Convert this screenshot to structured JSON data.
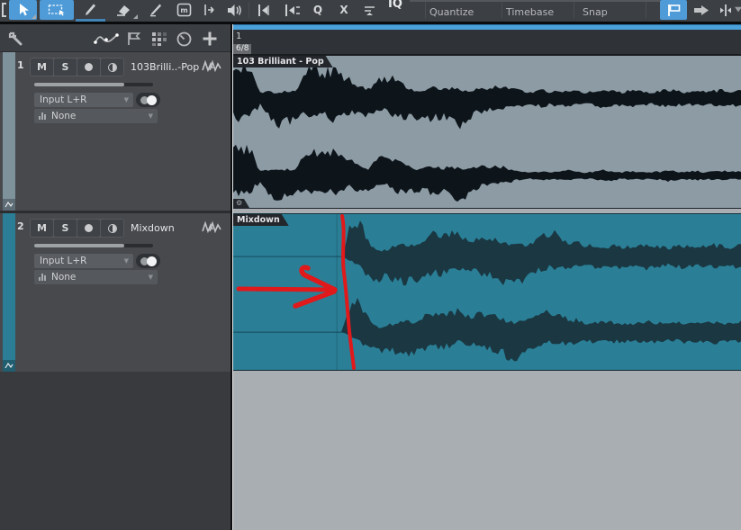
{
  "toolbar": {
    "tools": {
      "mute_glyph": "m",
      "q_glyph": "Q",
      "x_glyph": "X"
    },
    "iq_label": "IQ",
    "dropdown_labels": [
      "Quantize",
      "Timebase",
      "Snap"
    ],
    "accent_color": "#4E9BD8",
    "scrollbar_color": "#4AA0D8"
  },
  "track_panel": {
    "tracks": [
      {
        "number": "1",
        "mute": "M",
        "solo": "S",
        "name": "103Brilli..-Pop",
        "input": "Input L+R",
        "insert": "None",
        "color": "#7E929C"
      },
      {
        "number": "2",
        "mute": "M",
        "solo": "S",
        "name": "Mixdown",
        "input": "Input L+R",
        "insert": "None",
        "color": "#2B7E96"
      }
    ]
  },
  "arrange": {
    "ruler": {
      "bar_number": "1",
      "time_signature": "6/8"
    },
    "clips": [
      {
        "label": "103 Brilliant - Pop",
        "bg": "#8C9BA4",
        "wave": "#0D141A"
      },
      {
        "label": "Mixdown",
        "bg": "#2A7F96",
        "wave": "#1A3742"
      }
    ],
    "gear_glyph": "⚙",
    "annotation_color": "#E0191B"
  },
  "waveforms": {
    "t1l1u": [
      0.85,
      0.9,
      0.8,
      0.15,
      0.2,
      0.15,
      0.2,
      0.25,
      0.75,
      0.85,
      0.7,
      0.8,
      0.65,
      0.5,
      0.3,
      0.25,
      0.55,
      0.6,
      0.5,
      0.35,
      0.2,
      0.25,
      0.3,
      0.25,
      0.3,
      0.25,
      0.2,
      0.3,
      0.3,
      0.35,
      0.3,
      0.25,
      0.2,
      0.18,
      0.22,
      0.17,
      0.2,
      0.24,
      0.18,
      0.16,
      0.2,
      0.26,
      0.2,
      0.17,
      0.22,
      0.18,
      0.16,
      0.2,
      0.24,
      0.19,
      0.17,
      0.21,
      0.18,
      0.2,
      0.23,
      0.19,
      0.2
    ],
    "t1l1d": [
      0.55,
      0.6,
      0.5,
      0.2,
      0.6,
      0.75,
      0.7,
      0.55,
      0.45,
      0.55,
      0.5,
      0.6,
      0.45,
      0.4,
      0.5,
      0.45,
      0.3,
      0.35,
      0.55,
      0.6,
      0.55,
      0.5,
      0.6,
      0.55,
      0.65,
      0.75,
      0.6,
      0.4,
      0.35,
      0.3,
      0.28,
      0.28,
      0.22,
      0.2,
      0.24,
      0.19,
      0.22,
      0.26,
      0.2,
      0.18,
      0.22,
      0.28,
      0.22,
      0.19,
      0.24,
      0.2,
      0.18,
      0.22,
      0.26,
      0.21,
      0.19,
      0.23,
      0.2,
      0.22,
      0.25,
      0.21,
      0.22
    ],
    "t1l2u": [
      0.8,
      0.85,
      0.7,
      0.12,
      0.18,
      0.14,
      0.18,
      0.22,
      0.65,
      0.75,
      0.6,
      0.7,
      0.55,
      0.45,
      0.25,
      0.2,
      0.5,
      0.55,
      0.45,
      0.3,
      0.18,
      0.22,
      0.26,
      0.22,
      0.26,
      0.22,
      0.18,
      0.26,
      0.26,
      0.3,
      0.24,
      0.14,
      0.11,
      0.1,
      0.13,
      0.1,
      0.12,
      0.15,
      0.1,
      0.09,
      0.12,
      0.16,
      0.12,
      0.1,
      0.13,
      0.1,
      0.09,
      0.12,
      0.15,
      0.11,
      0.1,
      0.13,
      0.1,
      0.12,
      0.14,
      0.11,
      0.12
    ],
    "t1l2d": [
      0.5,
      0.55,
      0.45,
      0.18,
      0.55,
      0.7,
      0.65,
      0.5,
      0.4,
      0.5,
      0.45,
      0.55,
      0.4,
      0.35,
      0.45,
      0.4,
      0.28,
      0.3,
      0.5,
      0.55,
      0.5,
      0.45,
      0.55,
      0.5,
      0.6,
      0.7,
      0.55,
      0.35,
      0.3,
      0.26,
      0.24,
      0.16,
      0.12,
      0.11,
      0.14,
      0.11,
      0.13,
      0.16,
      0.11,
      0.1,
      0.13,
      0.17,
      0.13,
      0.11,
      0.14,
      0.11,
      0.1,
      0.13,
      0.16,
      0.12,
      0.11,
      0.14,
      0.11,
      0.13,
      0.15,
      0.12,
      0.13
    ],
    "t2l1u": [
      0,
      0,
      0,
      0,
      0,
      0,
      0,
      0,
      0,
      0,
      0,
      0,
      0,
      0.92,
      0.88,
      0.35,
      0.15,
      0.2,
      0.28,
      0.34,
      0.3,
      0.5,
      0.62,
      0.55,
      0.68,
      0.6,
      0.45,
      0.52,
      0.56,
      0.48,
      0.35,
      0.3,
      0.32,
      0.42,
      0.5,
      0.66,
      0.58,
      0.4,
      0.36,
      0.3,
      0.28,
      0.26,
      0.3,
      0.27,
      0.23,
      0.28,
      0.33,
      0.26,
      0.23,
      0.27,
      0.31,
      0.25,
      0.27,
      0.31,
      0.28,
      0.25,
      0.3
    ],
    "t2l1d": [
      0,
      0,
      0,
      0,
      0,
      0,
      0,
      0,
      0,
      0,
      0,
      0,
      0,
      0.12,
      0.3,
      0.55,
      0.6,
      0.5,
      0.68,
      0.76,
      0.64,
      0.5,
      0.44,
      0.5,
      0.4,
      0.32,
      0.36,
      0.44,
      0.5,
      0.54,
      0.72,
      0.8,
      0.66,
      0.45,
      0.36,
      0.3,
      0.32,
      0.36,
      0.3,
      0.29,
      0.31,
      0.27,
      0.31,
      0.29,
      0.25,
      0.3,
      0.35,
      0.28,
      0.25,
      0.29,
      0.32,
      0.27,
      0.29,
      0.32,
      0.29,
      0.27,
      0.31
    ],
    "t2l2u": [
      0,
      0,
      0,
      0,
      0,
      0,
      0,
      0,
      0,
      0,
      0,
      0,
      0,
      0.88,
      0.84,
      0.33,
      0.14,
      0.19,
      0.27,
      0.32,
      0.28,
      0.47,
      0.59,
      0.52,
      0.65,
      0.57,
      0.43,
      0.49,
      0.53,
      0.46,
      0.33,
      0.28,
      0.3,
      0.4,
      0.48,
      0.63,
      0.55,
      0.38,
      0.34,
      0.28,
      0.27,
      0.25,
      0.28,
      0.26,
      0.22,
      0.27,
      0.31,
      0.25,
      0.22,
      0.26,
      0.29,
      0.24,
      0.26,
      0.29,
      0.27,
      0.24,
      0.28
    ],
    "t2l2d": [
      0,
      0,
      0,
      0,
      0,
      0,
      0,
      0,
      0,
      0,
      0,
      0,
      0,
      0.11,
      0.28,
      0.52,
      0.57,
      0.48,
      0.65,
      0.72,
      0.6,
      0.47,
      0.42,
      0.47,
      0.38,
      0.3,
      0.34,
      0.42,
      0.47,
      0.51,
      0.68,
      0.76,
      0.63,
      0.43,
      0.34,
      0.28,
      0.3,
      0.34,
      0.28,
      0.27,
      0.29,
      0.26,
      0.29,
      0.27,
      0.24,
      0.28,
      0.33,
      0.26,
      0.24,
      0.27,
      0.3,
      0.26,
      0.27,
      0.3,
      0.27,
      0.26,
      0.29
    ]
  }
}
